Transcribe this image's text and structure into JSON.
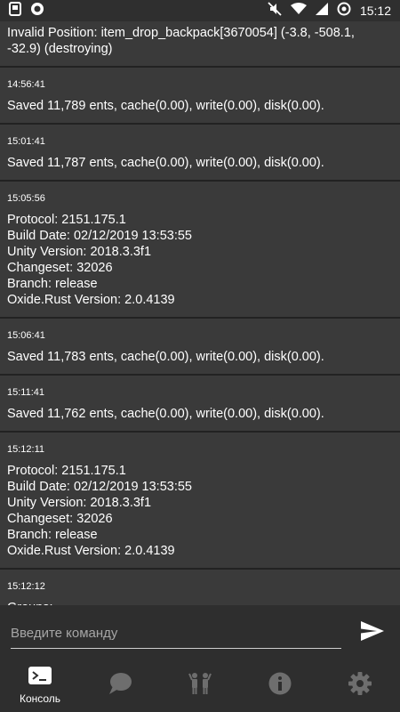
{
  "status_bar": {
    "time": "15:12"
  },
  "log_entries": [
    {
      "time": "",
      "text": "Invalid Position: item_drop_backpack[3670054] (-3.8, -508.1,\n-32.9) (destroying)"
    },
    {
      "time": "14:56:41",
      "text": "Saved 11,789 ents, cache(0.00), write(0.00), disk(0.00)."
    },
    {
      "time": "15:01:41",
      "text": "Saved 11,787 ents, cache(0.00), write(0.00), disk(0.00)."
    },
    {
      "time": "15:05:56",
      "text": "Protocol: 2151.175.1\nBuild Date: 02/12/2019 13:53:55\nUnity Version: 2018.3.3f1\nChangeset: 32026\nBranch: release\nOxide.Rust Version: 2.0.4139"
    },
    {
      "time": "15:06:41",
      "text": "Saved 11,783 ents, cache(0.00), write(0.00), disk(0.00)."
    },
    {
      "time": "15:11:41",
      "text": "Saved 11,762 ents, cache(0.00), write(0.00), disk(0.00)."
    },
    {
      "time": "15:12:11",
      "text": "Protocol: 2151.175.1\nBuild Date: 02/12/2019 13:53:55\nUnity Version: 2018.3.3f1\nChangeset: 32026\nBranch: release\nOxide.Rust Version: 2.0.4139"
    },
    {
      "time": "15:12:12",
      "text": "Groups:\ndefault, admin"
    }
  ],
  "command_input": {
    "placeholder": "Введите команду",
    "value": ""
  },
  "bottom_nav": {
    "console_label": "Консоль"
  },
  "icons": {
    "send": "send-icon",
    "console": "terminal-icon",
    "chat": "chat-icon",
    "players": "players-icon",
    "info": "info-icon",
    "settings": "gear-icon"
  },
  "colors": {
    "background": "#3a3a3a",
    "bar": "#2e2e2e",
    "divider": "#222222",
    "inactive_icon": "#6e6e6e",
    "placeholder": "#a6a6a6"
  }
}
